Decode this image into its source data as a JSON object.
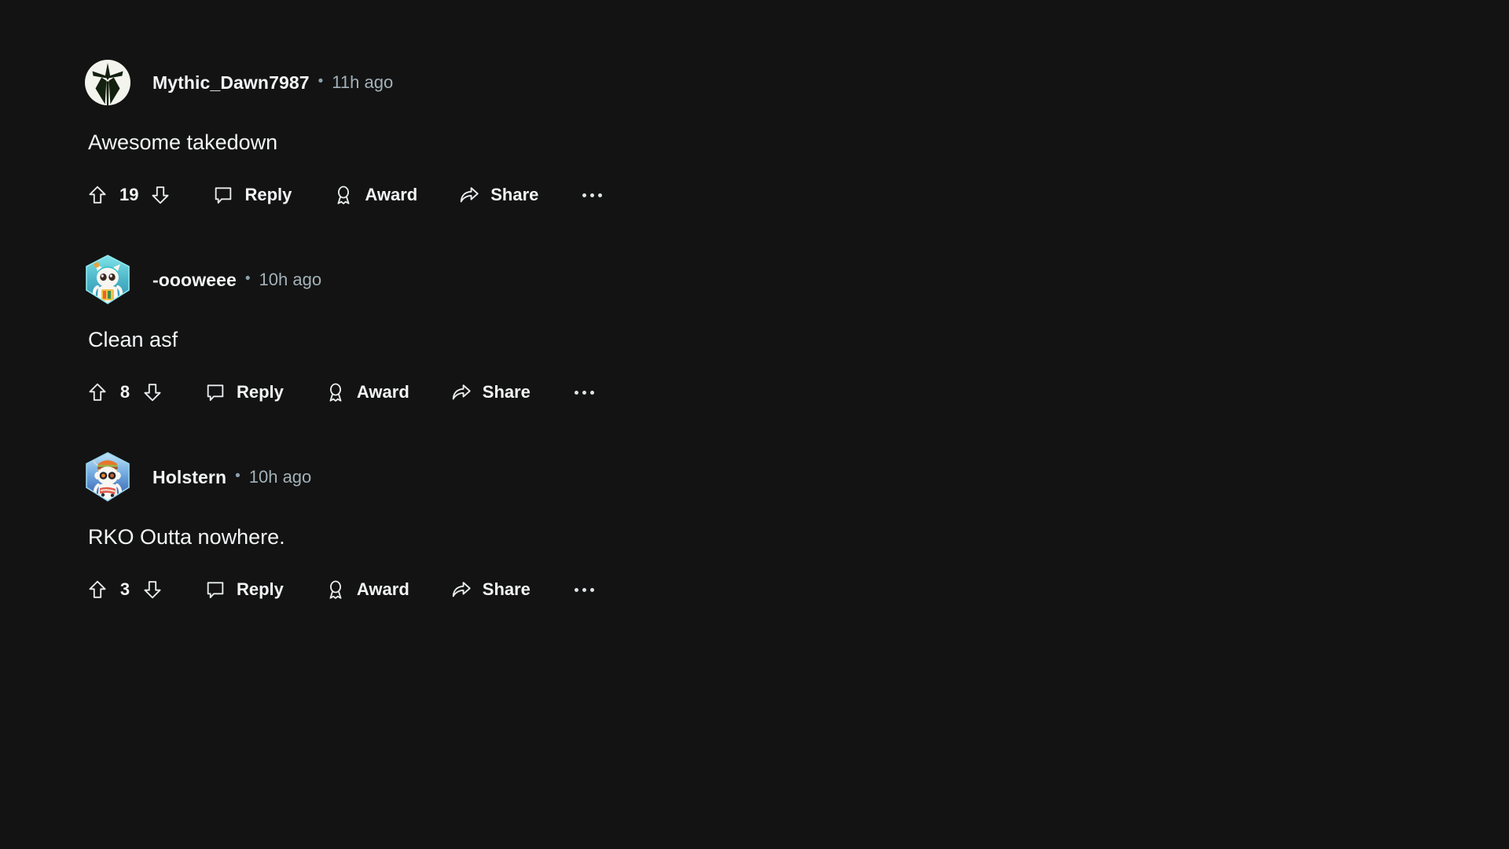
{
  "theme": {
    "background": "#131313",
    "text_primary": "#f2f4f5",
    "text_muted": "#a3b1b8"
  },
  "action_labels": {
    "reply": "Reply",
    "award": "Award",
    "share": "Share",
    "more": "more-options"
  },
  "separator": "•",
  "comments": [
    {
      "username": "Mythic_Dawn7987",
      "timestamp": "11h ago",
      "body": "Awesome takedown",
      "votes": "19",
      "avatar": "mythic-dawn-emblem-avatar"
    },
    {
      "username": "-oooweee",
      "timestamp": "10h ago",
      "body": "Clean asf",
      "votes": "8",
      "avatar": "snoo-cat-teal-avatar"
    },
    {
      "username": "Holstern",
      "timestamp": "10h ago",
      "body": "RKO Outta nowhere.",
      "votes": "3",
      "avatar": "snoo-burger-blue-avatar"
    }
  ]
}
